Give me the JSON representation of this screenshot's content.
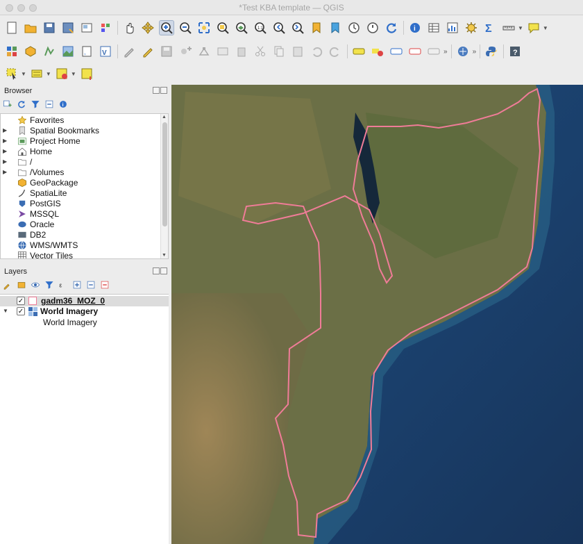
{
  "window": {
    "title": "*Test KBA template — QGIS"
  },
  "icons": {
    "toolbar1": [
      "new-project-icon",
      "open-project-icon",
      "save-project-icon",
      "save-as-icon",
      "print-layout-icon",
      "style-manager-icon",
      "pan-icon",
      "pan-to-selection-icon",
      "zoom-in-icon",
      "zoom-out-icon",
      "zoom-full-icon",
      "zoom-to-selection-icon",
      "zoom-to-layer-icon",
      "zoom-to-native-icon",
      "zoom-last-icon",
      "zoom-next-icon",
      "new-bookmark-icon",
      "show-bookmarks-icon",
      "temporal-controller-icon",
      "map-tips-icon",
      "refresh-icon",
      "identify-icon",
      "attribute-table-icon",
      "statistics-icon",
      "processing-icon",
      "sum-icon",
      "measure-icon",
      "annotation-icon"
    ],
    "toolbar2": [
      "data-source-manager-icon",
      "new-geopackage-icon",
      "add-vector-icon",
      "add-raster-icon",
      "add-delimited-icon",
      "virtual-layer-icon",
      "current-edits-icon",
      "toggle-editing-icon",
      "save-edits-icon",
      "add-feature-icon",
      "vertex-tool-icon",
      "modify-attributes-icon",
      "delete-feature-icon",
      "cut-icon",
      "copy-icon",
      "paste-icon",
      "undo-icon",
      "redo-icon",
      "label-icon",
      "label-pin-icon",
      "label-highlight-icon",
      "label-delete-icon",
      "label-rotate-icon",
      "plugin-icon",
      "python-icon",
      "help-icon"
    ],
    "toolbar3": [
      "select-features-icon",
      "select-by-value-icon",
      "deselect-icon",
      "select-location-icon"
    ],
    "browser_tools": [
      "add-selected-icon",
      "refresh-icon",
      "filter-icon",
      "collapse-all-icon",
      "info-icon"
    ],
    "layers_tools": [
      "style-panel-icon",
      "add-group-icon",
      "manage-visibility-icon",
      "filter-legend-icon",
      "expression-filter-icon",
      "expand-all-icon",
      "collapse-all-icon",
      "remove-layer-icon"
    ]
  },
  "browser": {
    "title": "Browser",
    "items": [
      {
        "label": "Favorites",
        "icon": "star-icon"
      },
      {
        "label": "Spatial Bookmarks",
        "icon": "bookmark-icon"
      },
      {
        "label": "Project Home",
        "icon": "project-home-icon"
      },
      {
        "label": "Home",
        "icon": "home-icon"
      },
      {
        "label": "/",
        "icon": "folder-icon"
      },
      {
        "label": "/Volumes",
        "icon": "folder-icon"
      },
      {
        "label": "GeoPackage",
        "icon": "geopackage-icon"
      },
      {
        "label": "SpatiaLite",
        "icon": "spatialite-icon"
      },
      {
        "label": "PostGIS",
        "icon": "postgis-icon"
      },
      {
        "label": "MSSQL",
        "icon": "mssql-icon"
      },
      {
        "label": "Oracle",
        "icon": "oracle-icon"
      },
      {
        "label": "DB2",
        "icon": "db2-icon"
      },
      {
        "label": "WMS/WMTS",
        "icon": "wms-icon"
      },
      {
        "label": "Vector Tiles",
        "icon": "vector-tiles-icon"
      }
    ],
    "db2_badge": "DB2"
  },
  "layers": {
    "title": "Layers",
    "items": [
      {
        "label": "gadm36_MOZ_0",
        "checked": true
      },
      {
        "label": "World Imagery",
        "checked": true
      },
      {
        "label": "World Imagery"
      }
    ],
    "check_mark": "✓"
  },
  "colors": {
    "boundary": "#f07c98",
    "accent": "#2f6ec9"
  }
}
